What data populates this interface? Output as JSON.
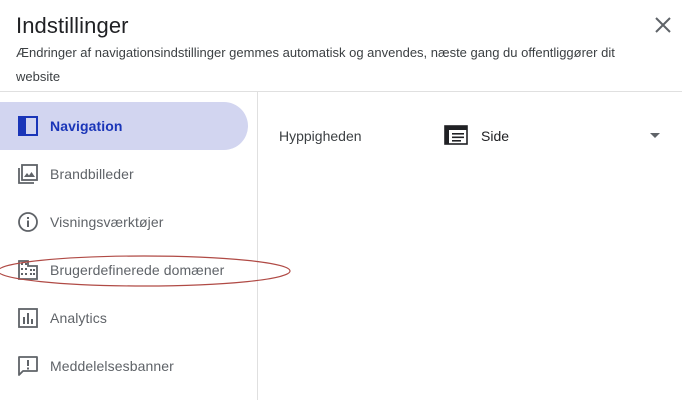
{
  "dialog": {
    "title": "Indstillinger",
    "subtitle": "Ændringer af navigationsindstillinger gemmes automatisk og anvendes, næste gang du offentliggører dit website",
    "close_icon": "close-icon"
  },
  "sidebar": {
    "items": [
      {
        "label": "Navigation",
        "icon": "navigation-icon",
        "active": true
      },
      {
        "label": "Brandbilleder",
        "icon": "image-icon",
        "active": false
      },
      {
        "label": "Visningsværktøjer",
        "icon": "info-icon",
        "active": false
      },
      {
        "label": "Brugerdefinerede domæner",
        "icon": "domain-icon",
        "active": false
      },
      {
        "label": "Analytics",
        "icon": "analytics-icon",
        "active": false
      },
      {
        "label": "Meddelelsesbanner",
        "icon": "announcement-icon",
        "active": false
      }
    ]
  },
  "main": {
    "frequency_label": "Hyppigheden",
    "frequency_value": "Side",
    "frequency_icon": "page-layout-icon"
  },
  "colors": {
    "active_bg": "#d2d5f0",
    "active_text": "#1a35b8",
    "annotation": "#b04a45"
  }
}
